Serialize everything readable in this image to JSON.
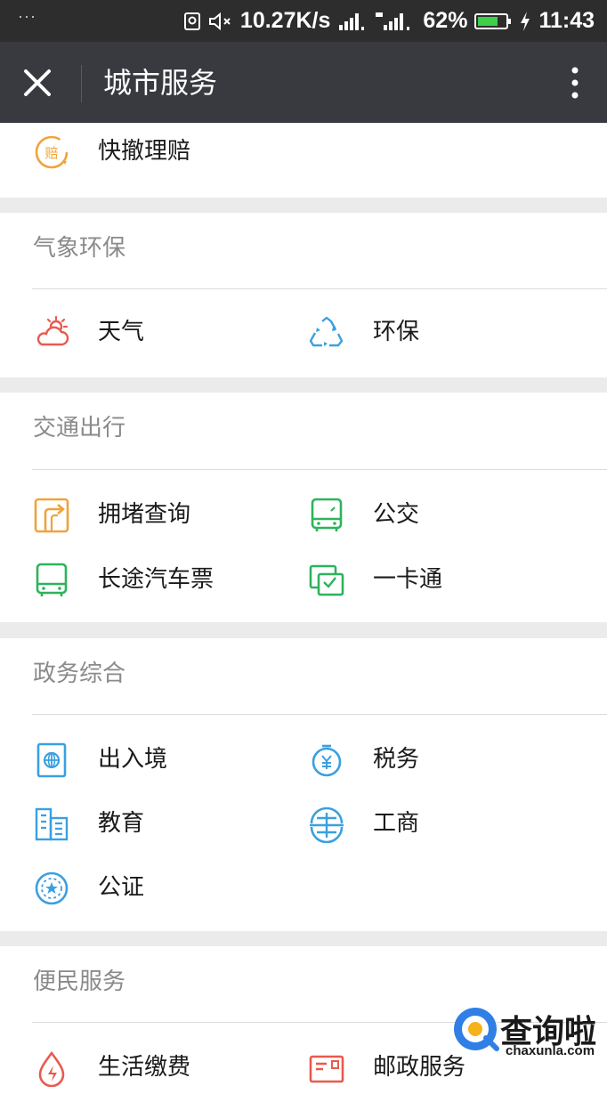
{
  "status_bar": {
    "dots": "···",
    "net_speed": "10.27K/s",
    "battery": "62%",
    "time": "11:43"
  },
  "header": {
    "title": "城市服务"
  },
  "top_item": {
    "label": "快撤理赔",
    "icon": "claim-icon"
  },
  "sections": [
    {
      "title": "气象环保",
      "items": [
        {
          "label": "天气",
          "icon": "weather-icon"
        },
        {
          "label": "环保",
          "icon": "recycle-icon"
        }
      ]
    },
    {
      "title": "交通出行",
      "items": [
        {
          "label": "拥堵查询",
          "icon": "traffic-icon"
        },
        {
          "label": "公交",
          "icon": "bus-icon"
        },
        {
          "label": "长途汽车票",
          "icon": "coach-icon"
        },
        {
          "label": "一卡通",
          "icon": "transit-card-icon"
        }
      ]
    },
    {
      "title": "政务综合",
      "items": [
        {
          "label": "出入境",
          "icon": "passport-icon"
        },
        {
          "label": "税务",
          "icon": "tax-icon"
        },
        {
          "label": "教育",
          "icon": "education-icon"
        },
        {
          "label": "工商",
          "icon": "business-icon"
        },
        {
          "label": "公证",
          "icon": "notary-icon"
        }
      ]
    },
    {
      "title": "便民服务",
      "items": [
        {
          "label": "生活缴费",
          "icon": "utility-payment-icon"
        },
        {
          "label": "邮政服务",
          "icon": "postal-icon"
        }
      ]
    }
  ],
  "watermark": {
    "text": "查询啦",
    "sub": "chaxunla.com"
  },
  "colors": {
    "orange": "#f0a33a",
    "red": "#e85a4f",
    "blue": "#3aa0e0",
    "green": "#2eb35c",
    "header_bg": "#393a3f",
    "gap_bg": "#ebebeb"
  }
}
